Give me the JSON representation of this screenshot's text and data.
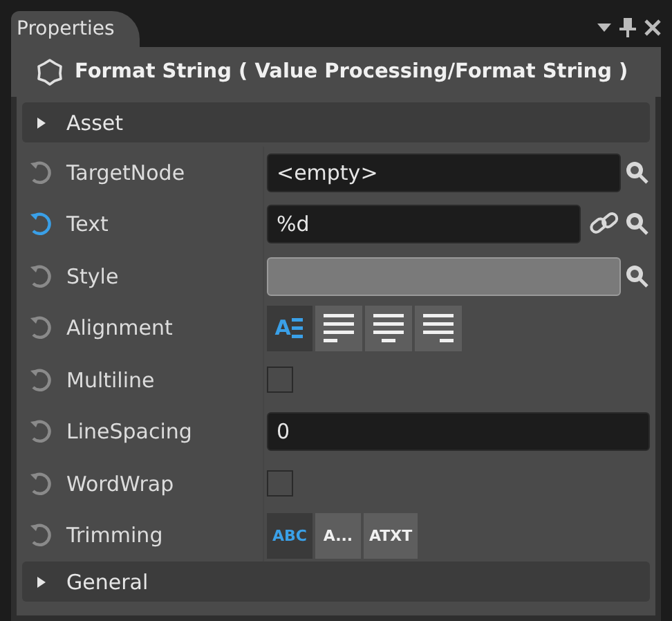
{
  "panel": {
    "tab": "Properties",
    "title": "Format String ( Value Processing/Format String )"
  },
  "sections": [
    {
      "label": "Asset",
      "expanded": false,
      "properties": [
        {
          "kind": "reference",
          "name": "TargetNode",
          "modified": false,
          "value": "<empty>"
        },
        {
          "kind": "text",
          "name": "Text",
          "modified": true,
          "value": "%d"
        },
        {
          "kind": "style",
          "name": "Style",
          "modified": false
        },
        {
          "kind": "alignment",
          "name": "Alignment",
          "modified": false,
          "options": [
            {
              "kind": "auto",
              "glyph": "A",
              "selected": true
            },
            {
              "kind": "left",
              "selected": false
            },
            {
              "kind": "center",
              "selected": false
            },
            {
              "kind": "right",
              "selected": false
            }
          ]
        },
        {
          "kind": "checkbox",
          "name": "Multiline",
          "modified": false,
          "checked": false
        },
        {
          "kind": "number",
          "name": "LineSpacing",
          "modified": false,
          "value": "0"
        },
        {
          "kind": "checkbox",
          "name": "WordWrap",
          "modified": false,
          "checked": false
        },
        {
          "kind": "trimming",
          "name": "Trimming",
          "modified": false,
          "options": [
            {
              "label": "ABC",
              "selected": true
            },
            {
              "label": "A...",
              "selected": false
            },
            {
              "label": "ATXT",
              "selected": false
            }
          ]
        }
      ]
    },
    {
      "label": "General",
      "expanded": false
    }
  ]
}
